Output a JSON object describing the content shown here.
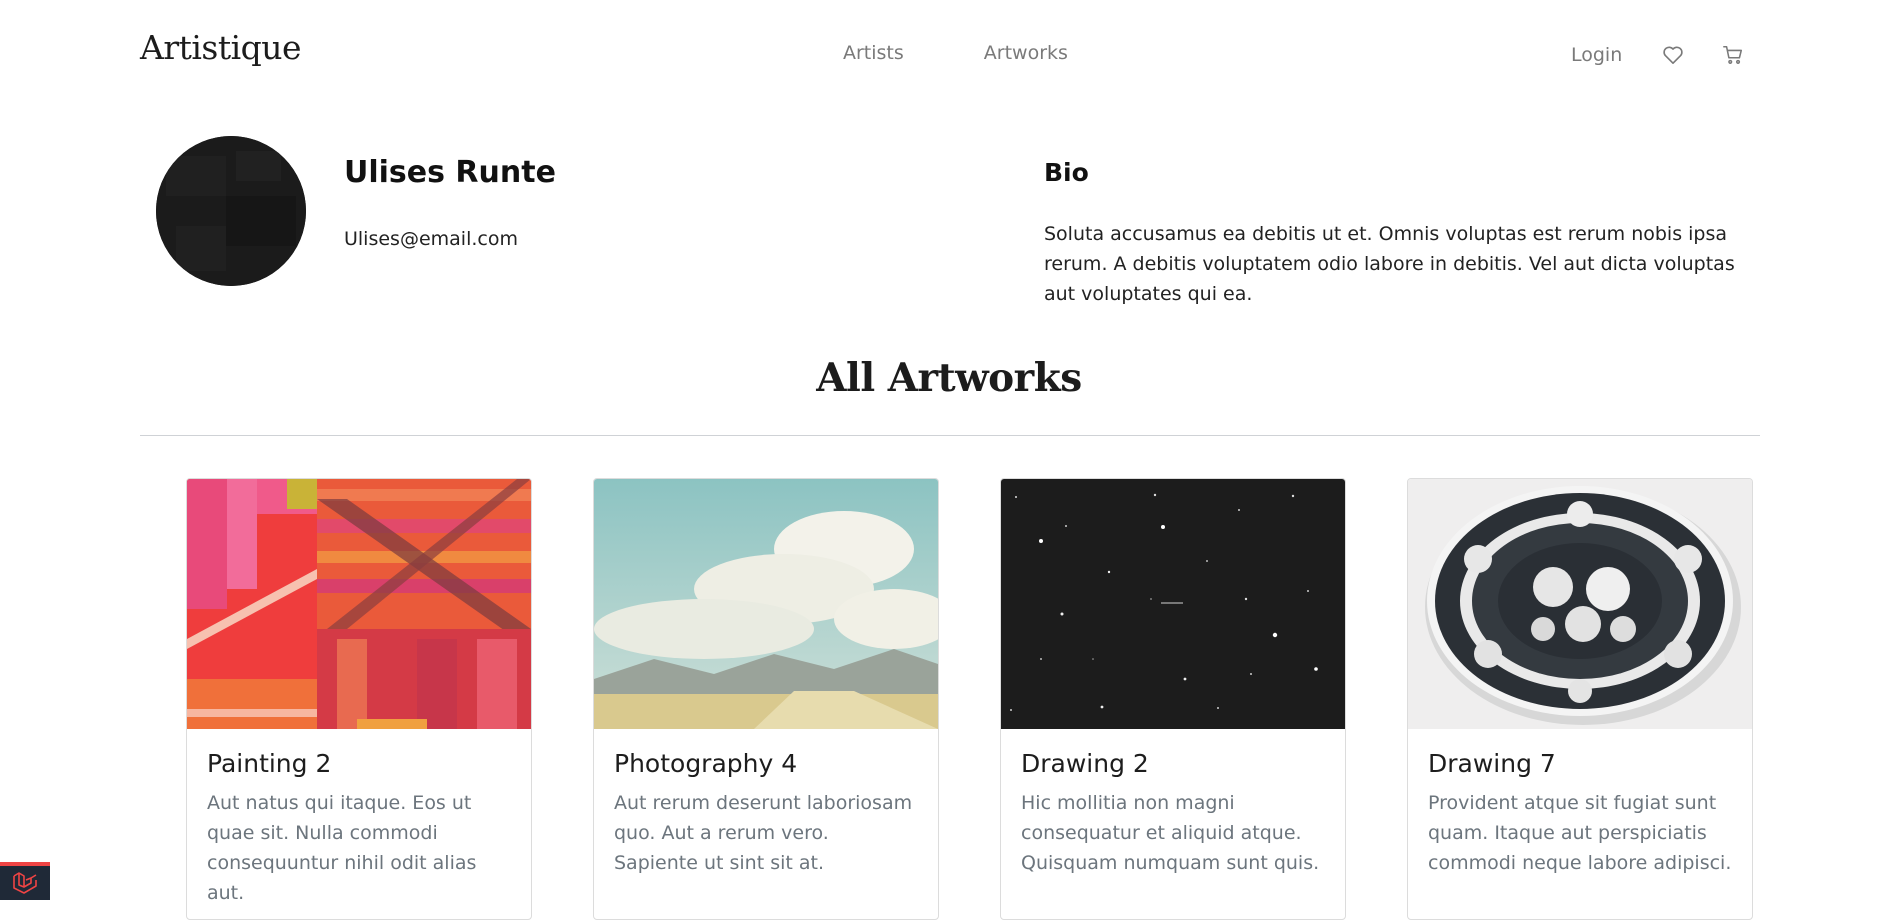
{
  "header": {
    "brand": "Artistique",
    "nav": [
      {
        "label": "Artists"
      },
      {
        "label": "Artworks"
      }
    ],
    "login_label": "Login",
    "icons": {
      "favorites": "heart-icon",
      "cart": "cart-icon"
    }
  },
  "artist": {
    "name": "Ulises Runte",
    "email": "Ulises@email.com",
    "avatar_icon": "avatar-image",
    "bio_title": "Bio",
    "bio": "Soluta accusamus ea debitis ut et. Omnis voluptas est rerum nobis ipsa rerum. A debitis voluptatem odio labore in debitis. Vel aut dicta voluptas aut voluptates qui ea."
  },
  "section": {
    "title": "All Artworks"
  },
  "artworks": [
    {
      "title": "Painting 2",
      "description": "Aut natus qui itaque. Eos ut quae sit. Nulla commodi consequuntur nihil odit alias aut.",
      "image": "geometric-painting-image"
    },
    {
      "title": "Photography 4",
      "description": "Aut rerum deserunt laboriosam quo. Aut a rerum vero. Sapiente ut sint sit at.",
      "image": "sky-clouds-photo-image"
    },
    {
      "title": "Drawing 2",
      "description": "Hic mollitia non magni consequatur et aliquid atque. Quisquam numquam sunt quis.",
      "image": "night-sky-stars-image"
    },
    {
      "title": "Drawing 7",
      "description": "Provident atque sit fugiat sunt quam. Itaque aut perspiciatis commodi neque labore adipisci.",
      "image": "decorated-plate-image"
    }
  ],
  "colors": {
    "accent_text": "#7a7a7a",
    "muted_text": "#6c757d",
    "badge_bg": "#1f2937",
    "badge_accent": "#ef4444"
  },
  "badge": {
    "icon": "laravel-logo-icon"
  }
}
